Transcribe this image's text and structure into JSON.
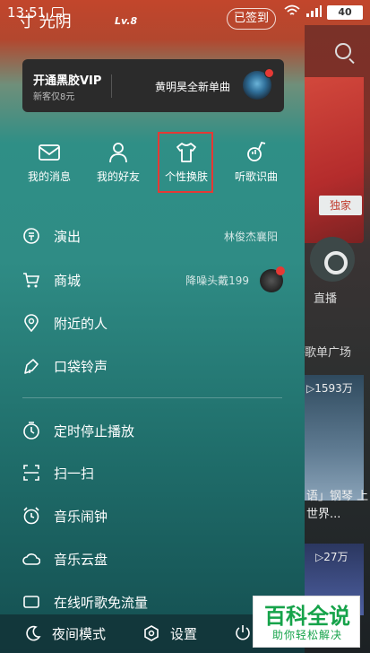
{
  "status_bar": {
    "time": "13:51",
    "battery": "40"
  },
  "header": {
    "username": "寸 光阴",
    "level": "Lv.8",
    "signin_label": "已签到"
  },
  "vip_card": {
    "title": "开通黑胶VIP",
    "subtitle": "新客仅8元",
    "promo": "黄明昊全新单曲"
  },
  "quick_actions": [
    {
      "label": "我的消息",
      "icon": "mail-icon"
    },
    {
      "label": "我的好友",
      "icon": "friends-icon"
    },
    {
      "label": "个性换肤",
      "icon": "tshirt-icon"
    },
    {
      "label": "听歌识曲",
      "icon": "music-recognize-icon"
    }
  ],
  "menu": {
    "items": [
      {
        "label": "演出",
        "extra": "林俊杰襄阳",
        "icon": "ticket-icon"
      },
      {
        "label": "商城",
        "extra": "降噪头戴199",
        "icon": "cart-icon"
      },
      {
        "label": "附近的人",
        "extra": "",
        "icon": "location-icon"
      },
      {
        "label": "口袋铃声",
        "extra": "",
        "icon": "ringtone-icon"
      },
      {
        "label": "定时停止播放",
        "extra": "",
        "icon": "timer-icon"
      },
      {
        "label": "扫一扫",
        "extra": "",
        "icon": "scan-icon"
      },
      {
        "label": "音乐闹钟",
        "extra": "",
        "icon": "alarm-icon"
      },
      {
        "label": "音乐云盘",
        "extra": "",
        "icon": "cloud-icon"
      },
      {
        "label": "在线听歌免流量",
        "extra": "",
        "icon": "data-icon"
      }
    ]
  },
  "bottom_bar": {
    "night_mode": "夜间模式",
    "settings": "设置"
  },
  "background": {
    "exclusive": "独家",
    "live": "直播",
    "playlist_square": "歌单广场",
    "count1": "▷1593万",
    "desc1": "语」钢琴 上世界...",
    "count2": "▷27万"
  },
  "watermark": {
    "title": "百科全说",
    "subtitle": "助你轻松解决"
  },
  "colors": {
    "highlight": "#e53935",
    "accent_red": "#e53935",
    "watermark_green": "#16a34a"
  }
}
